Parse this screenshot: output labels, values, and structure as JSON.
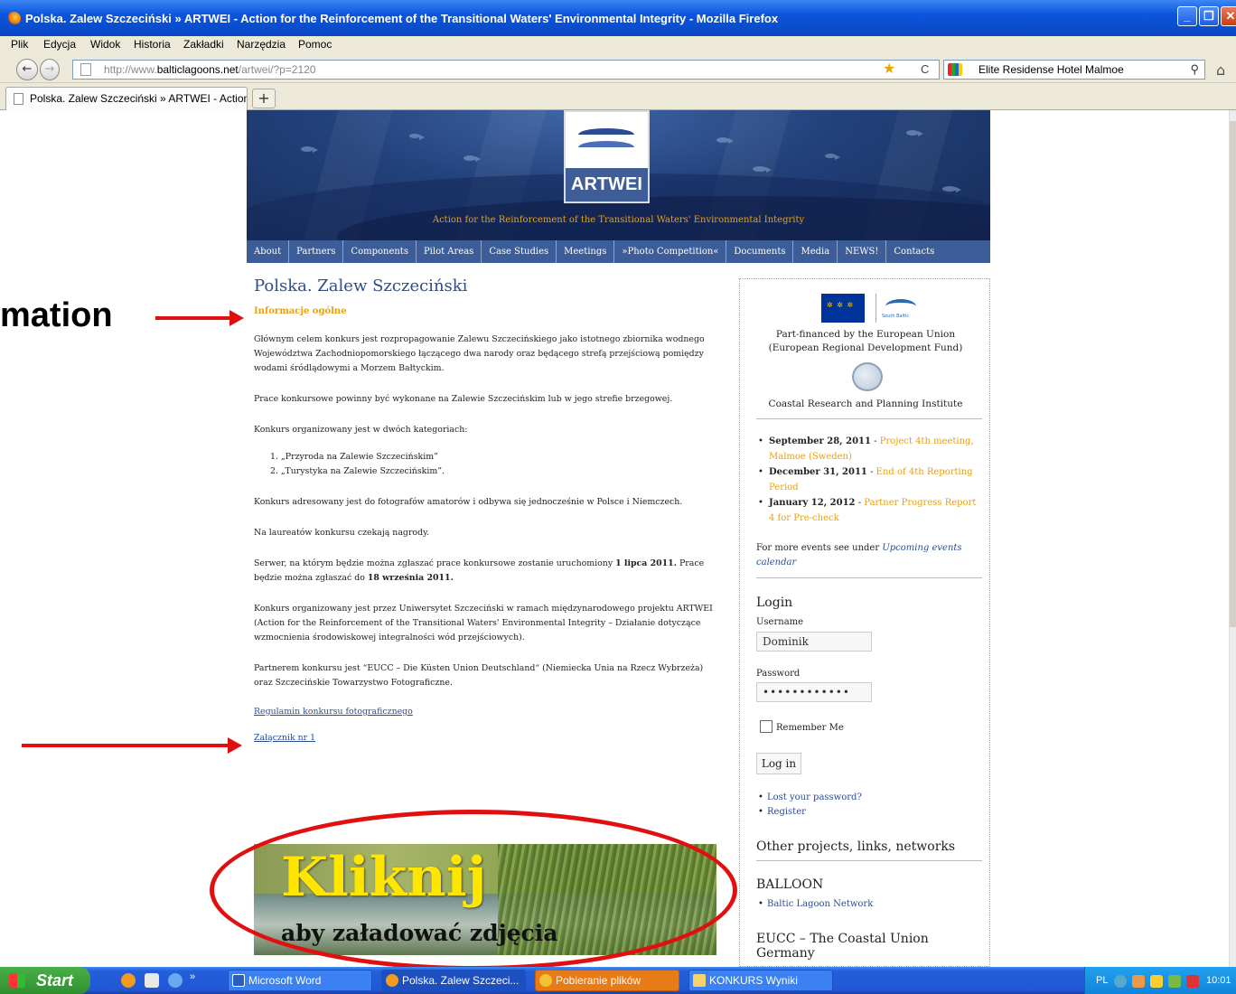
{
  "window": {
    "title": "Polska. Zalew Szczeciński » ARTWEI - Action for the Reinforcement of the Transitional Waters' Environmental Integrity - Mozilla Firefox"
  },
  "menu": [
    "Plik",
    "Edycja",
    "Widok",
    "Historia",
    "Zakładki",
    "Narzędzia",
    "Pomoc"
  ],
  "url": {
    "prefix": "http://www.",
    "domain": "balticlagoons.net",
    "path": "/artwei/?p=2120"
  },
  "search": {
    "value": "Elite Residense Hotel Malmoe"
  },
  "tab": {
    "label": "Polska. Zalew Szczeciński » ARTWEI - Action...",
    "new_tab": "+"
  },
  "header": {
    "logo": "ARTWEI",
    "tagline": "Action for the Reinforcement of the Transitional Waters' Environmental Integrity"
  },
  "nav": [
    "About",
    "Partners",
    "Components",
    "Pilot Areas",
    "Case Studies",
    "Meetings",
    "»Photo Competition«",
    "Documents",
    "Media",
    "NEWS!",
    "Contacts"
  ],
  "content": {
    "title": "Polska. Zalew Szczeciński",
    "heading": "Informacje ogólne",
    "p1": "Głównym celem konkurs jest rozpropagowanie Zalewu Szczecińskiego jako istotnego zbiornika wodnego Województwa Zachodniopomorskiego łączącego dwa narody oraz będącego strefą przejściową pomiędzy wodami śródlądowymi a Morzem Bałtyckim.",
    "p2": "Prace konkursowe powinny być wykonane na Zalewie Szczecińskim lub w jego strefie brzegowej.",
    "p3": "Konkurs organizowany jest w dwóch kategoriach:",
    "list": [
      "1.  „Przyroda na Zalewie Szczecińskim”",
      "2.  „Turystyka na Zalewie Szczecińskim”."
    ],
    "p4": "Konkurs adresowany jest do fotografów amatorów i odbywa się jednocześnie w Polsce i Niemczech.",
    "p5": "Na laureatów konkursu czekają nagrody.",
    "p6a": "Serwer, na którym będzie można zgłaszać prace konkursowe zostanie uruchomiony ",
    "p6b": "1 lipca 2011.",
    "p6c": " Prace będzie można zgłaszać do ",
    "p6d": "18 września 2011.",
    "p7": "Konkurs organizowany jest przez Uniwersytet Szczeciński w ramach międzynarodowego projektu ARTWEI (Action for the Reinforcement of the Transitional Waters' Environmental Integrity – Działanie dotyczące wzmocnienia środowiskowej integralności wód przejściowych).",
    "p8": "Partnerem konkursu jest “EUCC – Die Küsten Union Deutschland“ (Niemiecka Unia na Rzecz Wybrzeża) oraz Szczecińskie Towarzystwo Fotograficzne.",
    "link1": "Regulamin konkursu fotograficznego",
    "link2": "Załącznik nr 1",
    "banner_title": "Kliknij",
    "banner_sub": "aby załadować zdjęcia"
  },
  "sidebar": {
    "logo_label": "South Baltic",
    "funding": "Part-financed by the European Union (European Regional Development Fund)",
    "institute": "Coastal Research and Planning Institute",
    "events": [
      {
        "date": "September 28, 2011",
        "sep": " - ",
        "text": "Project 4th meeting, Malmoe (Sweden)"
      },
      {
        "date": "December 31, 2011",
        "sep": " - ",
        "text": "End of 4th Reporting Period"
      },
      {
        "date": "January 12, 2012",
        "sep": " - ",
        "text": "Partner Progress Report 4 for Pre-check"
      }
    ],
    "more_events_prefix": "For more events see under ",
    "more_events_link": "Upcoming events calendar",
    "login_title": "Login",
    "username_label": "Username",
    "username_value": "Dominik",
    "password_label": "Password",
    "password_value": "••••••••••••",
    "remember": "Remember Me",
    "login_button": "Log in",
    "lost_password": "Lost your password?",
    "register": "Register",
    "other_title": "Other projects, links, networks",
    "balloon_title": "BALLOON",
    "balloon_link": "Baltic Lagoon Network",
    "eucc_title": "EUCC – The Coastal Union Germany"
  },
  "annotation": {
    "label": "mation"
  },
  "taskbar": {
    "start": "Start",
    "chevron": "»",
    "tasks": [
      "Microsoft Word",
      "Polska. Zalew Szczeci...",
      "Pobieranie plików",
      "KONKURS Wyniki"
    ],
    "lang": "PL",
    "clock": "10:01"
  }
}
